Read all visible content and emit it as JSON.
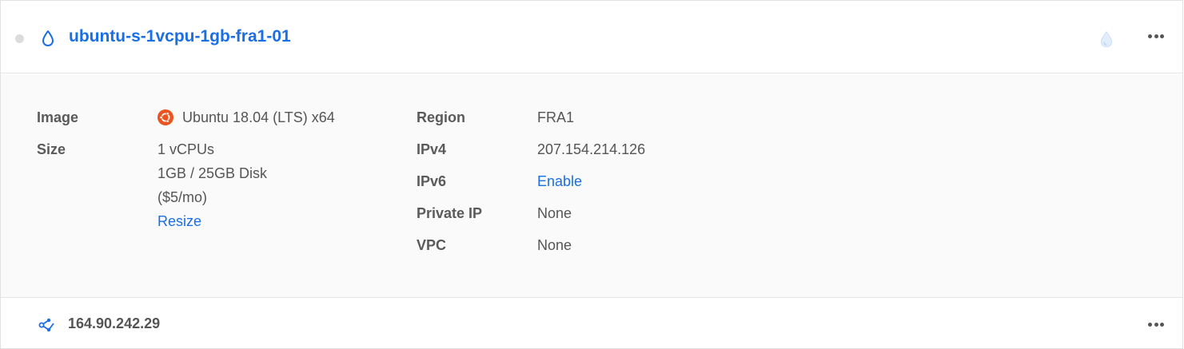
{
  "droplet": {
    "name": "ubuntu-s-1vcpu-1gb-fra1-01"
  },
  "details": {
    "image": {
      "label": "Image",
      "value": "Ubuntu 18.04 (LTS) x64"
    },
    "size": {
      "label": "Size",
      "vcpus": "1 vCPUs",
      "memory_disk": "1GB / 25GB Disk",
      "price": "($5/mo)",
      "resize_link": "Resize"
    },
    "region": {
      "label": "Region",
      "value": "FRA1"
    },
    "ipv4": {
      "label": "IPv4",
      "value": "207.154.214.126"
    },
    "ipv6": {
      "label": "IPv6",
      "value": "Enable"
    },
    "private_ip": {
      "label": "Private IP",
      "value": "None"
    },
    "vpc": {
      "label": "VPC",
      "value": "None"
    }
  },
  "floating_ip": {
    "address": "164.90.242.29"
  },
  "icons": {
    "status": "status-dot-icon",
    "droplet": "droplet-icon",
    "backups": "droplet-light-icon",
    "image": "ubuntu-logo-icon",
    "floating_ip": "network-share-icon",
    "more": "more-dots-icon"
  },
  "colors": {
    "link": "#1a6ee6",
    "ubuntu": "#e95420",
    "status_inactive": "#dcdcdc"
  }
}
